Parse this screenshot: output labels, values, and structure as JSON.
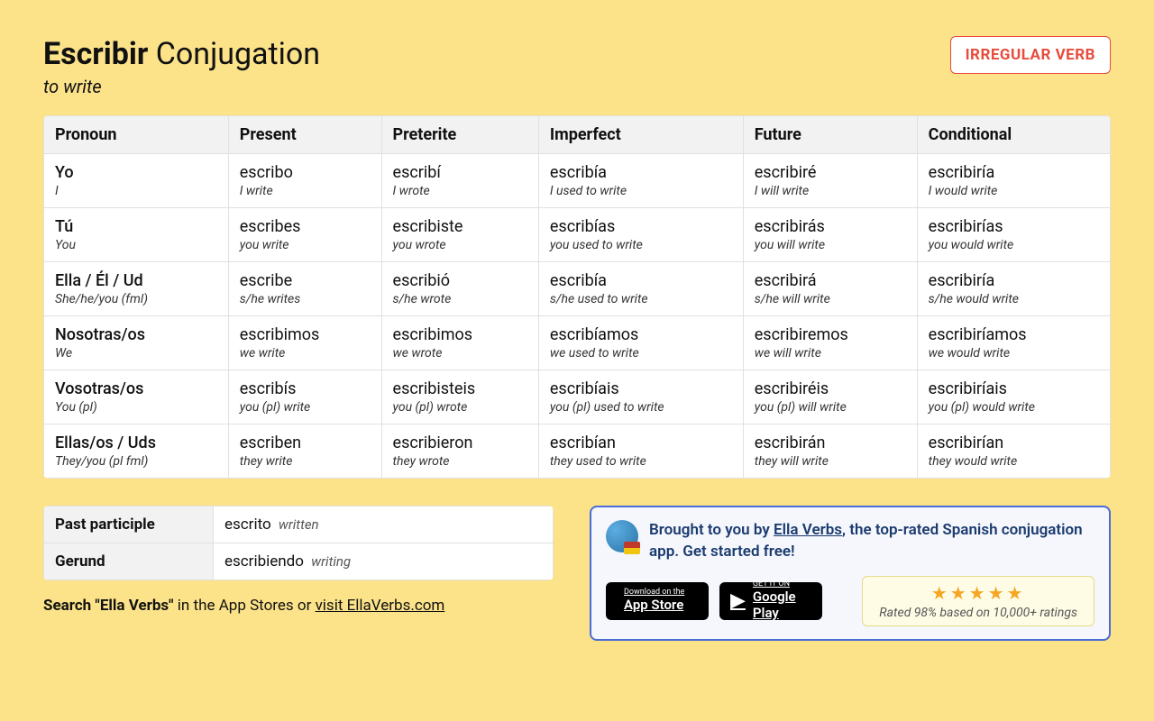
{
  "header": {
    "verb": "Escribir",
    "suffix": "Conjugation",
    "translation": "to write",
    "badge": "IRREGULAR VERB"
  },
  "columns": [
    "Pronoun",
    "Present",
    "Preterite",
    "Imperfect",
    "Future",
    "Conditional"
  ],
  "rows": [
    {
      "pronoun": {
        "es": "Yo",
        "en": "I"
      },
      "present": {
        "es": "escribo",
        "en": "I write"
      },
      "preterite": {
        "es": "escribí",
        "en": "I wrote"
      },
      "imperfect": {
        "es": "escribía",
        "en": "I used to write"
      },
      "future": {
        "es": "escribiré",
        "en": "I will write"
      },
      "conditional": {
        "es": "escribiría",
        "en": "I would write"
      }
    },
    {
      "pronoun": {
        "es": "Tú",
        "en": "You"
      },
      "present": {
        "es": "escribes",
        "en": "you write"
      },
      "preterite": {
        "es": "escribiste",
        "en": "you wrote"
      },
      "imperfect": {
        "es": "escribías",
        "en": "you used to write"
      },
      "future": {
        "es": "escribirás",
        "en": "you will write"
      },
      "conditional": {
        "es": "escribirías",
        "en": "you would write"
      }
    },
    {
      "pronoun": {
        "es": "Ella / Él / Ud",
        "en": "She/he/you (fml)"
      },
      "present": {
        "es": "escribe",
        "en": "s/he writes"
      },
      "preterite": {
        "es": "escribió",
        "en": "s/he wrote"
      },
      "imperfect": {
        "es": "escribía",
        "en": "s/he used to write"
      },
      "future": {
        "es": "escribirá",
        "en": "s/he will write"
      },
      "conditional": {
        "es": "escribiría",
        "en": "s/he would write"
      }
    },
    {
      "pronoun": {
        "es": "Nosotras/os",
        "en": "We"
      },
      "present": {
        "es": "escribimos",
        "en": "we write"
      },
      "preterite": {
        "es": "escribimos",
        "en": "we wrote"
      },
      "imperfect": {
        "es": "escribíamos",
        "en": "we used to write"
      },
      "future": {
        "es": "escribiremos",
        "en": "we will write"
      },
      "conditional": {
        "es": "escribiríamos",
        "en": "we would write"
      }
    },
    {
      "pronoun": {
        "es": "Vosotras/os",
        "en": "You (pl)"
      },
      "present": {
        "es": "escribís",
        "en": "you (pl) write"
      },
      "preterite": {
        "es": "escribisteis",
        "en": "you (pl) wrote"
      },
      "imperfect": {
        "es": "escribíais",
        "en": "you (pl) used to write"
      },
      "future": {
        "es": "escribiréis",
        "en": "you (pl) will write"
      },
      "conditional": {
        "es": "escribiríais",
        "en": "you (pl) would write"
      }
    },
    {
      "pronoun": {
        "es": "Ellas/os / Uds",
        "en": "They/you (pl fml)"
      },
      "present": {
        "es": "escriben",
        "en": "they write"
      },
      "preterite": {
        "es": "escribieron",
        "en": "they wrote"
      },
      "imperfect": {
        "es": "escribían",
        "en": "they used to write"
      },
      "future": {
        "es": "escribirán",
        "en": "they will write"
      },
      "conditional": {
        "es": "escribirían",
        "en": "they would write"
      }
    }
  ],
  "participles": {
    "past_label": "Past participle",
    "past_es": "escrito",
    "past_en": "written",
    "gerund_label": "Gerund",
    "gerund_es": "escribiendo",
    "gerund_en": "writing"
  },
  "search_line": {
    "prefix_bold": "Search \"Ella Verbs\"",
    "middle": " in the App Stores or ",
    "link": "visit EllaVerbs.com"
  },
  "promo": {
    "prefix": "Brought to you by ",
    "link": "Ella Verbs",
    "suffix": ", the top-rated Spanish conjugation app. Get started free!",
    "appstore_small": "Download on the",
    "appstore_big": "App Store",
    "play_small": "GET IT ON",
    "play_big": "Google Play",
    "stars": "★★★★★",
    "rating_text": "Rated 98% based on 10,000+ ratings"
  }
}
